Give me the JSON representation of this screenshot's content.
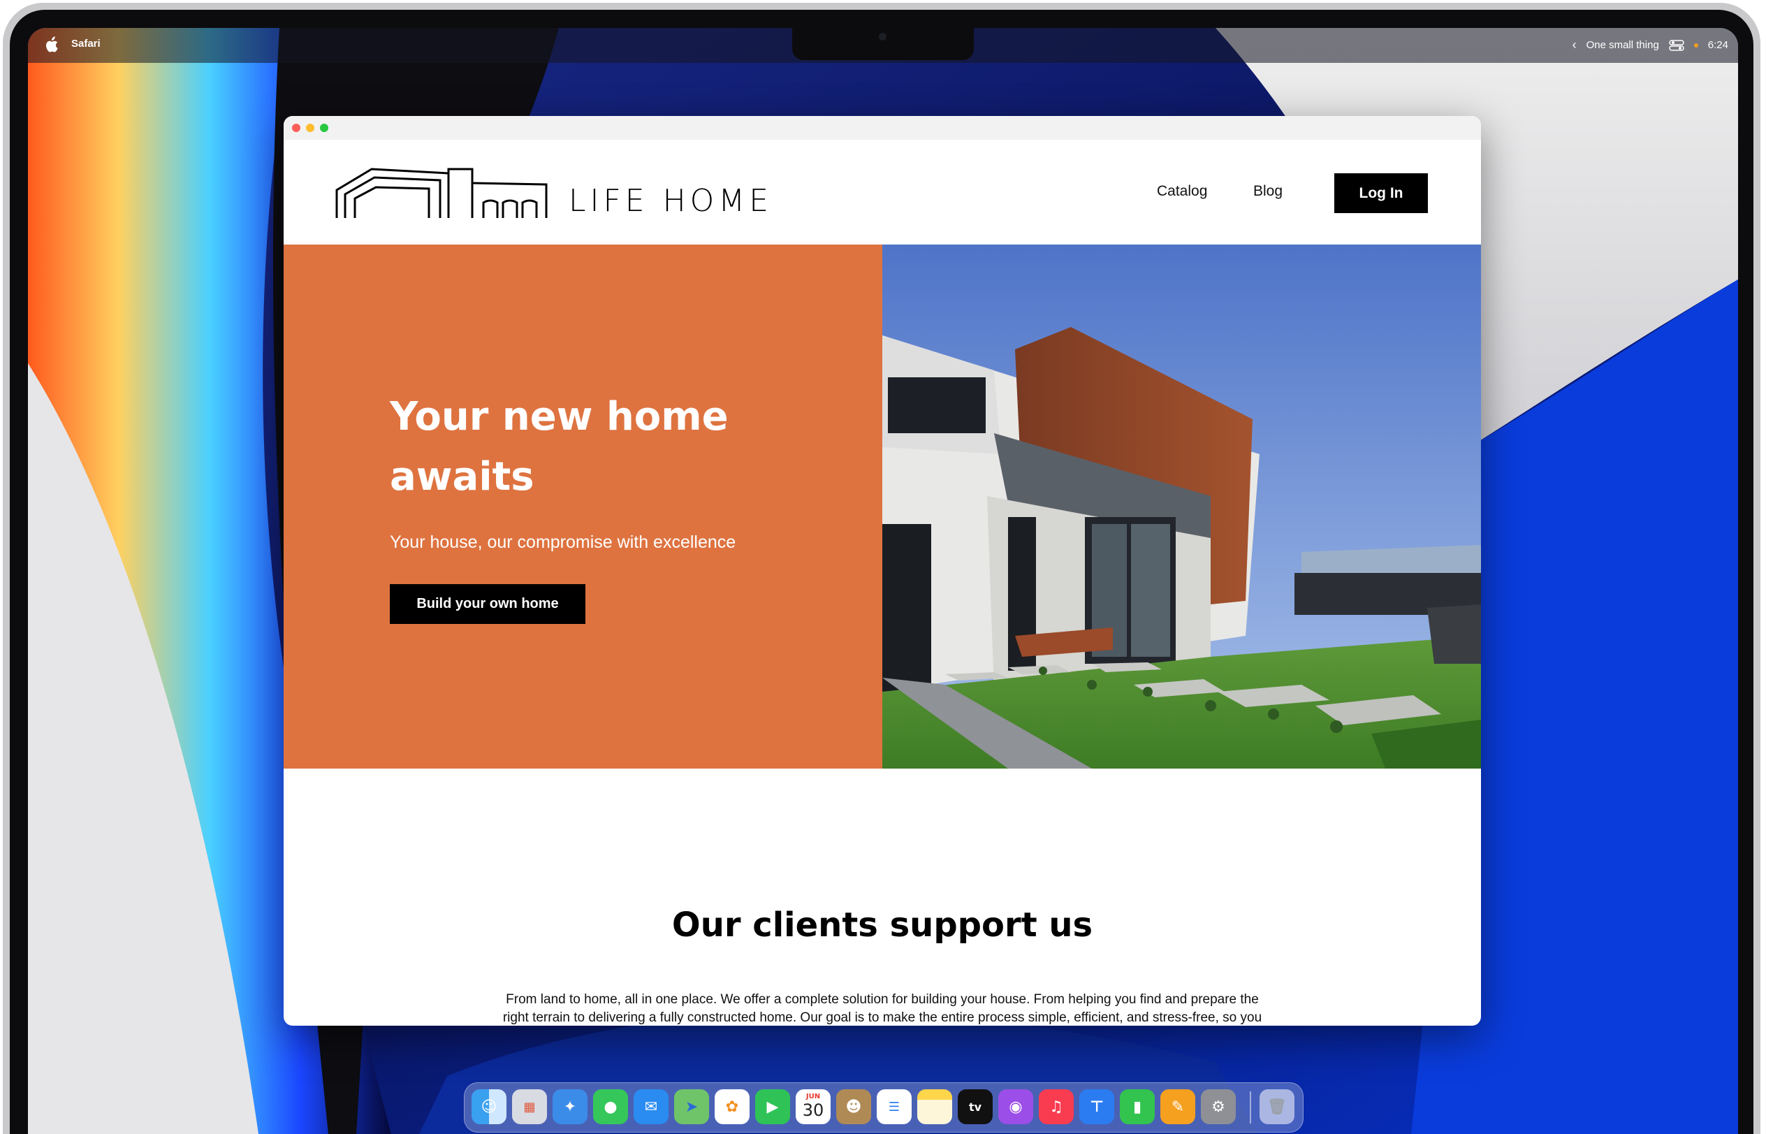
{
  "menubar": {
    "app_name": "Safari",
    "now_playing": "One small thing",
    "time": "6:24"
  },
  "site": {
    "brand": "LIFE HOME",
    "nav": {
      "catalog": "Catalog",
      "blog": "Blog",
      "login": "Log In"
    },
    "hero": {
      "title": "Your new home awaits",
      "subtitle": "Your house, our compromise with excellence",
      "cta": "Build your own home",
      "background_color": "#de7340"
    },
    "clients": {
      "title": "Our clients support us",
      "text": "From land to home, all in one place. We offer a complete solution for building your house. From helping you find and prepare the right terrain to delivering a fully constructed home. Our goal is to make the entire process simple, efficient, and stress-free, so you can focus on what really matters: enjoying your future home."
    }
  },
  "dock": {
    "calendar_month": "JUN",
    "calendar_day": "30",
    "apps": [
      "finder-icon",
      "launchpad-icon",
      "safari-icon",
      "messages-icon",
      "mail-icon",
      "maps-icon",
      "photos-icon",
      "facetime-icon",
      "calendar-icon",
      "contacts-icon",
      "reminders-icon",
      "notes-icon",
      "tv-icon",
      "podcasts-icon",
      "music-icon",
      "keynote-icon",
      "numbers-icon",
      "pages-icon",
      "settings-icon",
      "trash-icon"
    ]
  },
  "colors": {
    "accent": "#de7340",
    "button": "#000000"
  }
}
